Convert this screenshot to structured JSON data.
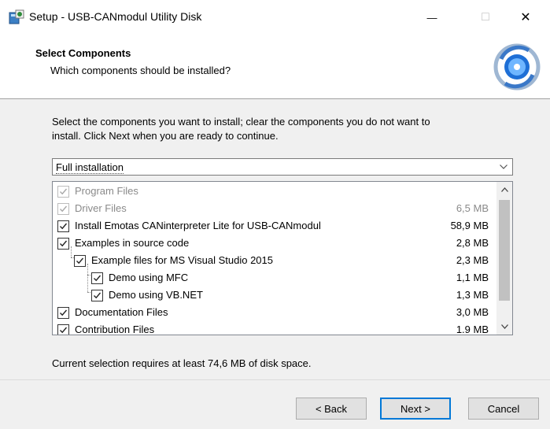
{
  "window": {
    "title": "Setup - USB-CANmodul Utility Disk",
    "icon": "setup-installer-icon",
    "minimize_glyph": "—",
    "maximize_glyph": "□",
    "close_glyph": "✕"
  },
  "header": {
    "title": "Select Components",
    "subtitle": "Which components should be installed?",
    "icon": "wizard-disc-icon"
  },
  "intro_line1": "Select the components you want to install; clear the components you do not want to",
  "intro_line2": "install. Click Next when you are ready to continue.",
  "install_type": {
    "selected": "Full installation"
  },
  "components": [
    {
      "label": "Program Files",
      "size": "",
      "checked": true,
      "disabled": true,
      "level": 0
    },
    {
      "label": "Driver Files",
      "size": "6,5 MB",
      "checked": true,
      "disabled": true,
      "level": 0
    },
    {
      "label": "Install Emotas CANinterpreter Lite for USB-CANmodul",
      "size": "58,9 MB",
      "checked": true,
      "disabled": false,
      "level": 0
    },
    {
      "label": "Examples in source code",
      "size": "2,8 MB",
      "checked": true,
      "disabled": false,
      "level": 0
    },
    {
      "label": "Example files for MS Visual Studio 2015",
      "size": "2,3 MB",
      "checked": true,
      "disabled": false,
      "level": 1
    },
    {
      "label": "Demo using MFC",
      "size": "1,1 MB",
      "checked": true,
      "disabled": false,
      "level": 2
    },
    {
      "label": "Demo using VB.NET",
      "size": "1,3 MB",
      "checked": true,
      "disabled": false,
      "level": 2
    },
    {
      "label": "Documentation Files",
      "size": "3,0 MB",
      "checked": true,
      "disabled": false,
      "level": 0
    },
    {
      "label": "Contribution Files",
      "size": "1.9 MB",
      "checked": true,
      "disabled": false,
      "level": 0
    }
  ],
  "disk_space": "Current selection requires at least 74,6 MB of disk space.",
  "buttons": {
    "back": "< Back",
    "next": "Next >",
    "cancel": "Cancel"
  }
}
